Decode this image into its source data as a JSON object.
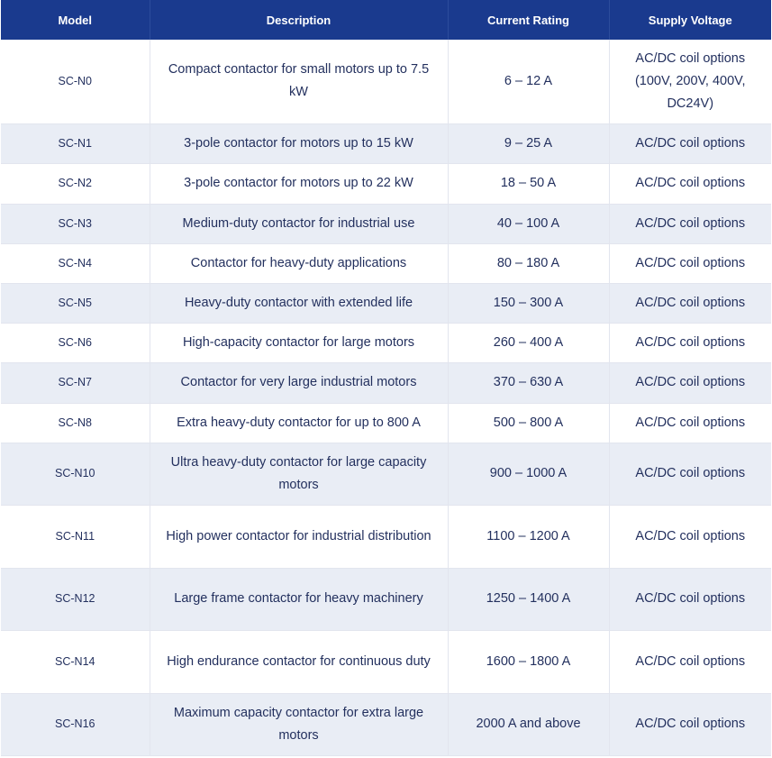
{
  "table": {
    "headers": [
      "Model",
      "Description",
      "Current Rating",
      "Supply Voltage"
    ],
    "rows": [
      {
        "model": "SC-N0",
        "description": "Compact contactor for small motors up to 7.5 kW",
        "rating": "6 – 12 A",
        "voltage": "AC/DC coil options (100V, 200V, 400V, DC24V)"
      },
      {
        "model": "SC-N1",
        "description": "3-pole contactor for motors up to 15 kW",
        "rating": "9 – 25 A",
        "voltage": "AC/DC coil options"
      },
      {
        "model": "SC-N2",
        "description": "3-pole contactor for motors up to 22 kW",
        "rating": "18 – 50 A",
        "voltage": "AC/DC coil options"
      },
      {
        "model": "SC-N3",
        "description": "Medium-duty contactor for industrial use",
        "rating": "40 – 100 A",
        "voltage": "AC/DC coil options"
      },
      {
        "model": "SC-N4",
        "description": "Contactor for heavy-duty applications",
        "rating": "80 – 180 A",
        "voltage": "AC/DC coil options"
      },
      {
        "model": "SC-N5",
        "description": "Heavy-duty contactor with extended life",
        "rating": "150 – 300 A",
        "voltage": "AC/DC coil options"
      },
      {
        "model": "SC-N6",
        "description": "High-capacity contactor for large motors",
        "rating": "260 – 400 A",
        "voltage": "AC/DC coil options"
      },
      {
        "model": "SC-N7",
        "description": "Contactor for very large industrial motors",
        "rating": "370 – 630 A",
        "voltage": "AC/DC coil options"
      },
      {
        "model": "SC-N8",
        "description": "Extra heavy-duty contactor for up to 800 A",
        "rating": "500 – 800 A",
        "voltage": "AC/DC coil options"
      },
      {
        "model": "SC-N10",
        "description": "Ultra heavy-duty contactor for large capacity motors",
        "rating": "900 – 1000 A",
        "voltage": "AC/DC coil options"
      },
      {
        "model": "SC-N11",
        "description": "High power contactor for industrial distribution",
        "rating": "1100 – 1200 A",
        "voltage": "AC/DC coil options"
      },
      {
        "model": "SC-N12",
        "description": "Large frame contactor for heavy machinery",
        "rating": "1250 – 1400 A",
        "voltage": "AC/DC coil options"
      },
      {
        "model": "SC-N14",
        "description": "High endurance contactor for continuous duty",
        "rating": "1600 – 1800 A",
        "voltage": "AC/DC coil options"
      },
      {
        "model": "SC-N16",
        "description": "Maximum capacity contactor for extra large motors",
        "rating": "2000 A and above",
        "voltage": "AC/DC coil options"
      }
    ]
  },
  "colors": {
    "header_bg": "#1a3a8e",
    "header_text": "#ffffff",
    "body_text": "#23305e",
    "stripe_bg": "#e9edf5"
  }
}
